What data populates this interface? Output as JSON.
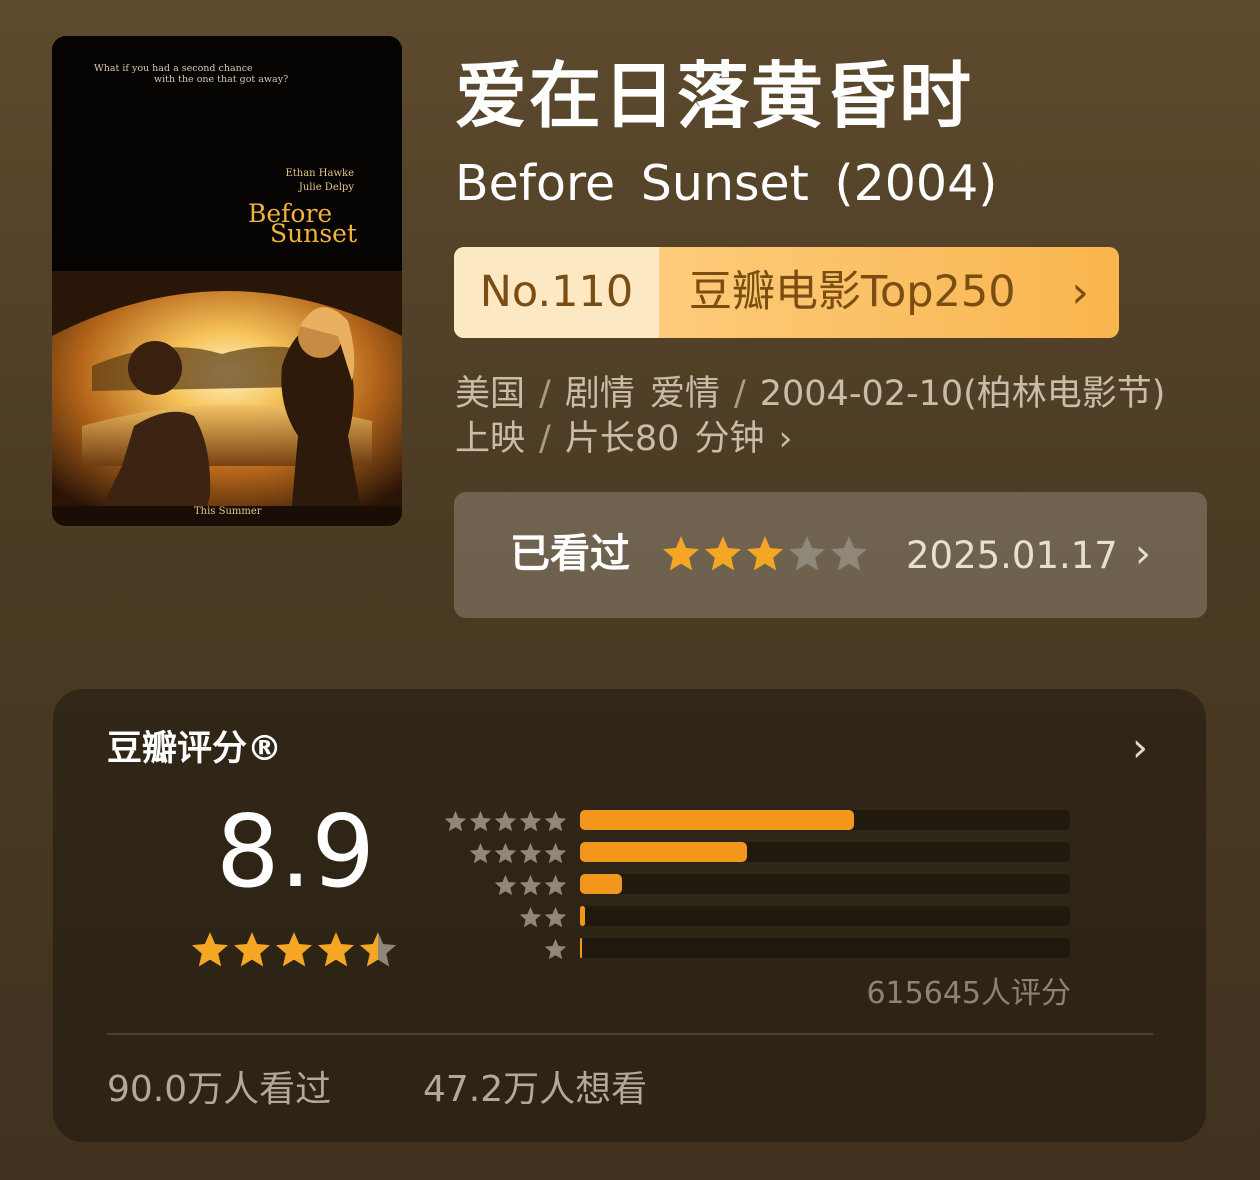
{
  "poster": {
    "tagline": [
      "What if you had a second chance",
      "with the one that got away?"
    ],
    "cast": [
      "Ethan Hawke",
      "Julie Delpy"
    ],
    "title": [
      "Before",
      "Sunset"
    ],
    "release_note": "This Summer"
  },
  "movie": {
    "title_cn": "爱在日落黄昏时",
    "title_en": "Before  Sunset  (2004)"
  },
  "rank": {
    "number": "No.110",
    "list": "豆瓣电影Top250",
    "chevron": "›"
  },
  "meta": {
    "country": "美国",
    "genres": "剧情  爱情",
    "release": "2004-02-10(柏林电影节)上映",
    "runtime": "片长80 分钟",
    "separator": "/",
    "chevron": "›"
  },
  "user_status": {
    "label": "已看过",
    "stars": 3,
    "max_stars": 5,
    "date": "2025.01.17",
    "chevron": "›"
  },
  "rating": {
    "title": "豆瓣评分®",
    "chevron": "›",
    "score": "8.9",
    "stars": 4.5,
    "max_stars": 5,
    "distribution": [
      {
        "stars": 5,
        "fraction": 0.56
      },
      {
        "stars": 4,
        "fraction": 0.34
      },
      {
        "stars": 3,
        "fraction": 0.085
      },
      {
        "stars": 2,
        "fraction": 0.01
      },
      {
        "stars": 1,
        "fraction": 0.005
      }
    ],
    "count": "615645人评分",
    "watched": "90.0万人看过",
    "wish": "47.2万人想看"
  },
  "colors": {
    "accent": "#f2961c",
    "star_on": "#f5a623",
    "star_off": "#8f8779",
    "rank_text": "#7a4d12"
  }
}
